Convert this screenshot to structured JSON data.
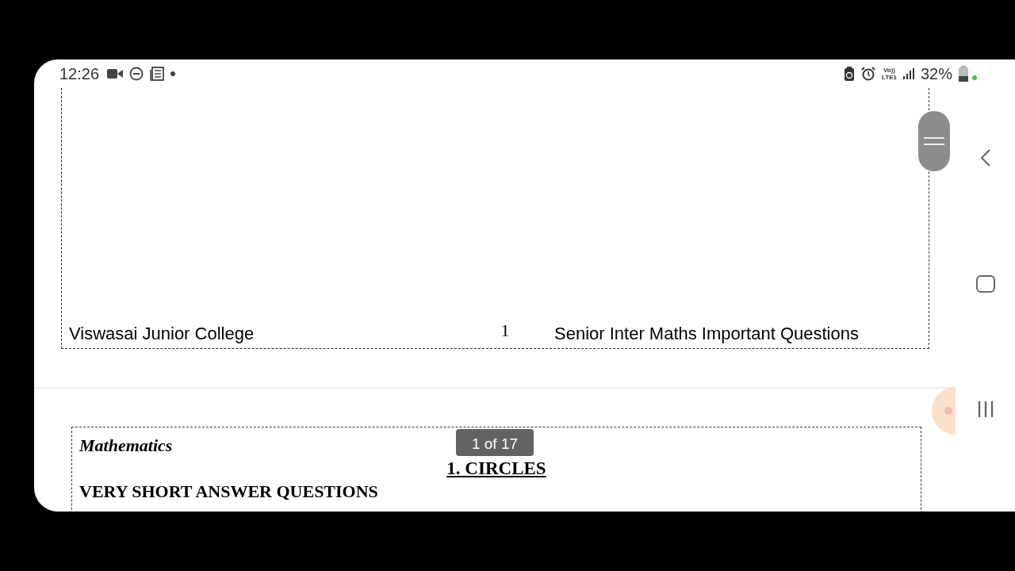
{
  "status_bar": {
    "time": "12:26",
    "network_top": "Vo))",
    "network_bottom": "LTE1",
    "battery": "32%"
  },
  "document": {
    "pages": [
      {
        "kind": "footer",
        "left": "Viswasai Junior College",
        "center": "1",
        "right": "Senior Inter Maths Important Questions"
      },
      {
        "kind": "header",
        "subject": "Mathematics",
        "title": "1. CIRCLES",
        "section": "VERY SHORT ANSWER QUESTIONS"
      }
    ]
  },
  "page_indicator": "1 of 17"
}
